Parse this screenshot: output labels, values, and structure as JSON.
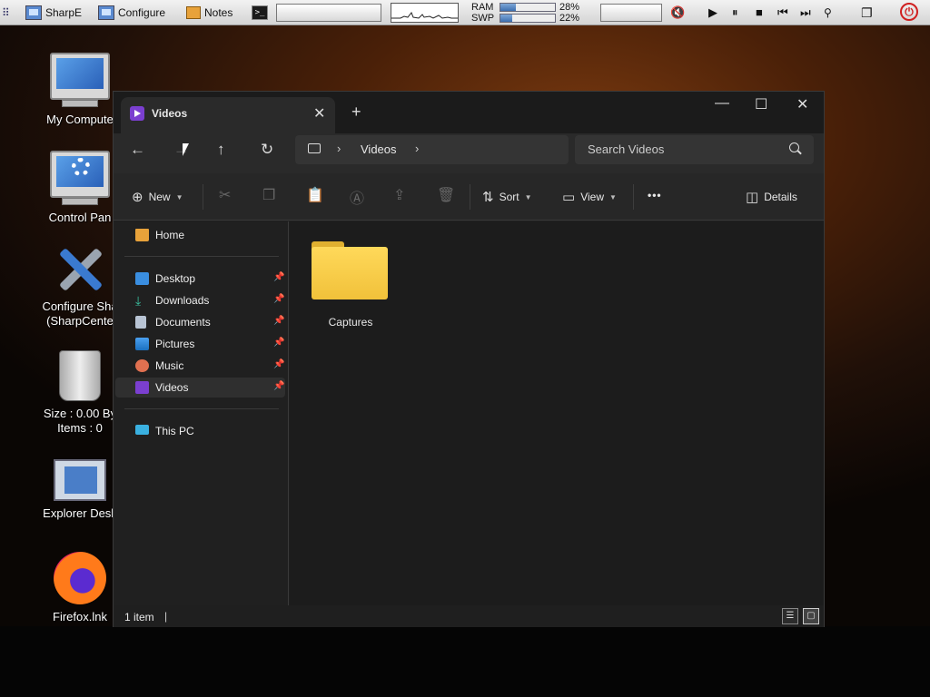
{
  "taskbar": {
    "items": [
      "SharpE",
      "Configure",
      "Notes"
    ],
    "ram_label": "RAM",
    "swp_label": "SWP",
    "ram_value": "28%",
    "swp_value": "22%",
    "ram_fraction": 0.28,
    "swp_fraction": 0.22,
    "terminal_glyph": ">_",
    "media": {
      "play": "▶",
      "pause": "⏸",
      "stop": "■",
      "prev": "⏮",
      "next": "⏭"
    },
    "power_glyph": "⏻"
  },
  "desktop": {
    "icons": [
      {
        "label": "My Compute",
        "icon": "computer-icon"
      },
      {
        "label": "Control Pan",
        "icon": "control-panel-icon"
      },
      {
        "label": "Configure Sha\n(SharpCente",
        "icon": "tools-icon"
      },
      {
        "label": "Size : 0.00 By\nItems : 0",
        "icon": "trash-icon"
      },
      {
        "label": "Explorer Desk",
        "icon": "explorer-icon"
      },
      {
        "label": "Firefox.lnk",
        "icon": "firefox-icon"
      }
    ]
  },
  "window": {
    "tab_title": "Videos",
    "tab_close": "✕",
    "new_tab": "+",
    "controls": {
      "minimize": "—",
      "maximize": "☐",
      "close": "✕"
    },
    "nav": {
      "back": "←",
      "forward": "→",
      "up": "↑",
      "refresh": "↻"
    },
    "breadcrumb": {
      "sep": "›",
      "current": "Videos"
    },
    "search_placeholder": "Search Videos",
    "commands": {
      "new_label": "New",
      "sort_label": "Sort",
      "view_label": "View",
      "more_label": "•••",
      "details_label": "Details"
    },
    "sidebar": {
      "home": "Home",
      "quick": [
        "Desktop",
        "Downloads",
        "Documents",
        "Pictures",
        "Music",
        "Videos"
      ],
      "selected": "Videos",
      "this_pc": "This PC"
    },
    "content": {
      "folders": [
        {
          "name": "Captures"
        }
      ]
    },
    "status": {
      "count": "1 item",
      "caret": "|"
    }
  },
  "colors": {
    "accent": "#7b3fd0",
    "folder": "#f1c13a",
    "window_bg": "#1f1f1f"
  }
}
